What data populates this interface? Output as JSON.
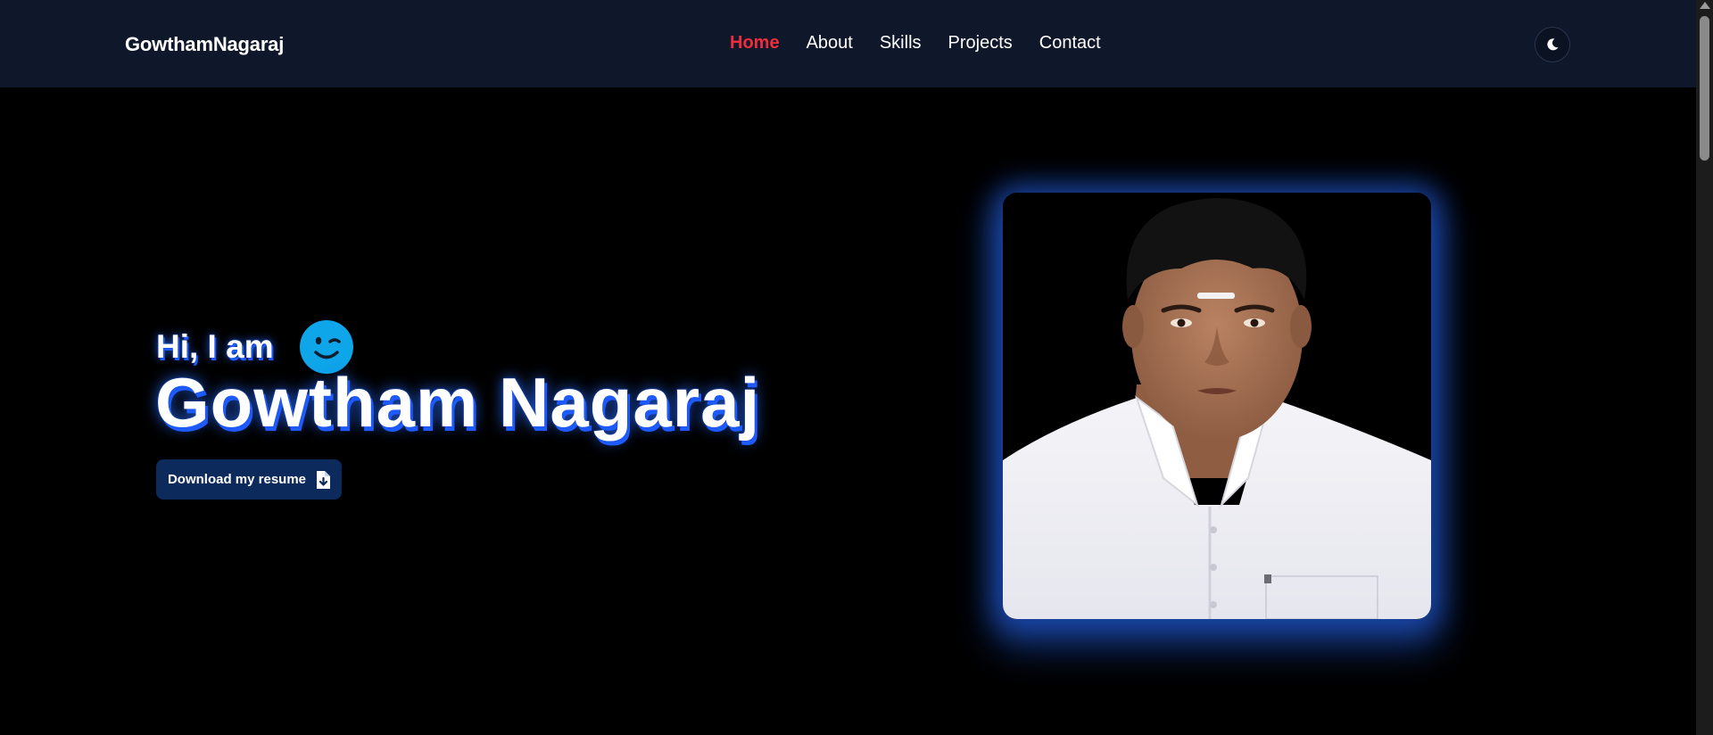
{
  "navbar": {
    "brand": "GowthamNagaraj",
    "links": [
      {
        "label": "Home",
        "active": true
      },
      {
        "label": "About",
        "active": false
      },
      {
        "label": "Skills",
        "active": false
      },
      {
        "label": "Projects",
        "active": false
      },
      {
        "label": "Contact",
        "active": false
      }
    ],
    "theme_toggle_icon": "moon-icon"
  },
  "hero": {
    "greeting": "Hi, I am",
    "greeting_icon": "winking-smiley-icon",
    "name": "Gowtham Nagaraj",
    "resume_button": {
      "label": "Download my resume",
      "icon": "file-download-icon"
    },
    "photo_icon": "profile-photo"
  },
  "colors": {
    "navbar_bg": "#0f172a",
    "page_bg": "#000000",
    "active_link": "#ef2d3c",
    "accent_blue": "#2563eb",
    "button_bg": "#0c2a5c",
    "smiley": "#0ea5e9"
  }
}
